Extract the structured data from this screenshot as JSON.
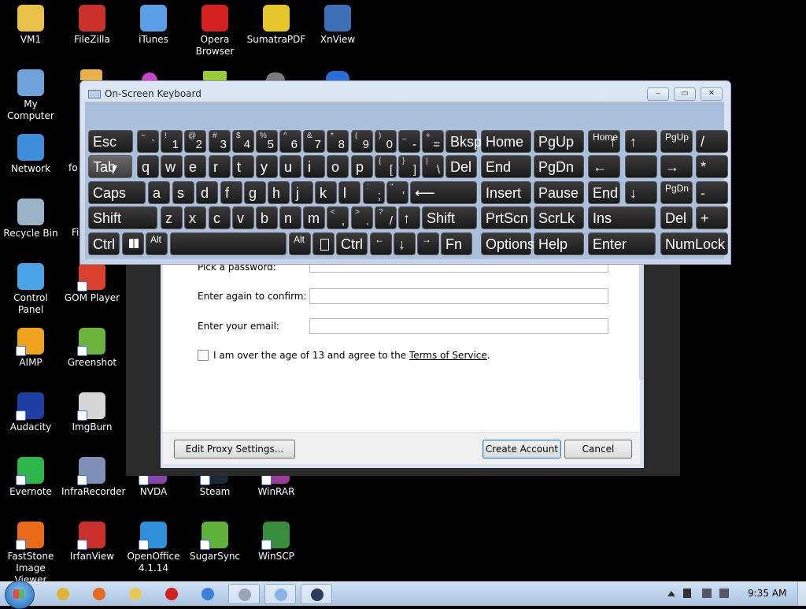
{
  "desktop": {
    "icons": [
      {
        "label": "VM1",
        "icon": "folder-icon",
        "color": "#e9c14a"
      },
      {
        "label": "FileZilla",
        "icon": "filezilla-icon",
        "color": "#c9302c"
      },
      {
        "label": "iTunes",
        "icon": "itunes-icon",
        "color": "#5a9ee6"
      },
      {
        "label": "Opera Browser",
        "icon": "opera-icon",
        "color": "#d4201f"
      },
      {
        "label": "SumatraPDF",
        "icon": "sumatrapdf-icon",
        "color": "#e6c52a"
      },
      {
        "label": "XnView",
        "icon": "xnview-icon",
        "color": "#3d6fb6"
      },
      {
        "label": "My Computer",
        "icon": "computer-icon",
        "color": "#6fa3d8"
      },
      {
        "label": "Network",
        "icon": "network-icon",
        "color": "#3c8fd8"
      },
      {
        "label": "Recycle Bin",
        "icon": "recycle-bin-icon",
        "color": "#9bb3c6"
      },
      {
        "label": "Control Panel",
        "icon": "control-panel-icon",
        "color": "#4aa3e6"
      },
      {
        "label": "GOM Player",
        "icon": "gom-player-icon",
        "color": "#d9412c"
      },
      {
        "label": "AIMP",
        "icon": "aimp-icon",
        "color": "#f0a31c"
      },
      {
        "label": "Greenshot",
        "icon": "greenshot-icon",
        "color": "#6cb33e"
      },
      {
        "label": "Audacity",
        "icon": "audacity-icon",
        "color": "#1f3fa3"
      },
      {
        "label": "ImgBurn",
        "icon": "imgburn-icon",
        "color": "#d6d6d6"
      },
      {
        "label": "Evernote",
        "icon": "evernote-icon",
        "color": "#2fb64a"
      },
      {
        "label": "InfraRecorder",
        "icon": "infrarecorder-icon",
        "color": "#7f8fb6"
      },
      {
        "label": "NVDA",
        "icon": "nvda-icon",
        "color": "#8b44ac"
      },
      {
        "label": "Steam",
        "icon": "steam-icon",
        "color": "#1b2838"
      },
      {
        "label": "WinRAR",
        "icon": "winrar-icon",
        "color": "#9b3b9b"
      },
      {
        "label": "FastStone Image Viewer",
        "icon": "faststone-icon",
        "color": "#e86b1c"
      },
      {
        "label": "IrfanView",
        "icon": "irfanview-icon",
        "color": "#c9302c"
      },
      {
        "label": "OpenOffice 4.1.14",
        "icon": "openoffice-icon",
        "color": "#2f8fd8"
      },
      {
        "label": "SugarSync",
        "icon": "sugarsync-icon",
        "color": "#5fb33a"
      },
      {
        "label": "WinSCP",
        "icon": "winscp-icon",
        "color": "#3a8d3a"
      }
    ],
    "partial_labels": {
      "fo": "fo",
      "fi": "Fi"
    }
  },
  "steam_dialog": {
    "password_label": "Pick a password:",
    "confirm_label": "Enter again to confirm:",
    "email_label": "Enter your email:",
    "tos_prefix": "I am over the age of 13 and agree to the ",
    "tos_link": "Terms of Service",
    "tos_suffix": ".",
    "proxy_button": "Edit Proxy Settings...",
    "create_button": "Create Account",
    "cancel_button": "Cancel"
  },
  "osk": {
    "title": "On-Screen Keyboard",
    "minimize": "–",
    "restore": "▭",
    "close": "✕",
    "rows": [
      [
        {
          "t": "Esc"
        },
        {
          "s": "~",
          "b": "`"
        },
        {
          "s": "!",
          "b": "1"
        },
        {
          "s": "@",
          "b": "2"
        },
        {
          "s": "#",
          "b": "3"
        },
        {
          "s": "$",
          "b": "4"
        },
        {
          "s": "%",
          "b": "5"
        },
        {
          "s": "^",
          "b": "6"
        },
        {
          "s": "&",
          "b": "7"
        },
        {
          "s": "*",
          "b": "8"
        },
        {
          "s": "(",
          "b": "9"
        },
        {
          "s": ")",
          "b": "0"
        },
        {
          "s": "_",
          "b": "-"
        },
        {
          "s": "+",
          "b": "="
        },
        {
          "t": "Bksp"
        },
        {
          "t": "Home"
        },
        {
          "t": "PgUp"
        },
        {
          "t": "Home",
          "n": "↑",
          "sm": true
        },
        {
          "t": "↑"
        },
        {
          "t": "PgUp",
          "sm": true
        },
        {
          "t": "/"
        }
      ],
      [
        {
          "t": "Tab"
        },
        {
          "t": "q"
        },
        {
          "t": "w"
        },
        {
          "t": "e"
        },
        {
          "t": "r"
        },
        {
          "t": "t"
        },
        {
          "t": "y"
        },
        {
          "t": "u"
        },
        {
          "t": "i"
        },
        {
          "t": "o"
        },
        {
          "t": "p"
        },
        {
          "s": "{",
          "b": "["
        },
        {
          "s": "}",
          "b": "]"
        },
        {
          "s": "|",
          "b": "\\"
        },
        {
          "t": "Del"
        },
        {
          "t": "End"
        },
        {
          "t": "PgDn"
        },
        {
          "t": "←"
        },
        {
          "t": ""
        },
        {
          "t": "→"
        },
        {
          "t": "*"
        }
      ],
      [
        {
          "t": "Caps"
        },
        {
          "t": "a"
        },
        {
          "t": "s"
        },
        {
          "t": "d"
        },
        {
          "t": "f"
        },
        {
          "t": "g"
        },
        {
          "t": "h"
        },
        {
          "t": "j"
        },
        {
          "t": "k"
        },
        {
          "t": "l"
        },
        {
          "s": ":",
          "b": ";"
        },
        {
          "s": "\"",
          "b": "'"
        },
        {
          "t": "⟵"
        },
        {
          "t": "Insert"
        },
        {
          "t": "Pause"
        },
        {
          "t": "End"
        },
        {
          "t": "↓"
        },
        {
          "t": "PgDn",
          "sm": true
        },
        {
          "t": "-"
        }
      ],
      [
        {
          "t": "Shift"
        },
        {
          "t": "z"
        },
        {
          "t": "x"
        },
        {
          "t": "c"
        },
        {
          "t": "v"
        },
        {
          "t": "b"
        },
        {
          "t": "n"
        },
        {
          "t": "m"
        },
        {
          "s": "<",
          "b": ","
        },
        {
          "s": ">",
          "b": "."
        },
        {
          "s": "?",
          "b": "/"
        },
        {
          "t": "↑"
        },
        {
          "t": "Shift"
        },
        {
          "t": "PrtScn"
        },
        {
          "t": "ScrLk"
        },
        {
          "t": "Ins"
        },
        {
          "t": "Del"
        },
        {
          "t": "+"
        }
      ],
      [
        {
          "t": "Ctrl"
        },
        {
          "t": "win"
        },
        {
          "t": "Alt",
          "sm": true
        },
        {
          "t": ""
        },
        {
          "t": "Alt",
          "sm": true
        },
        {
          "t": "menu"
        },
        {
          "t": "Ctrl"
        },
        {
          "t": "←",
          "sm": true
        },
        {
          "t": "↓"
        },
        {
          "t": "→",
          "sm": true
        },
        {
          "t": "Fn"
        },
        {
          "t": "Options"
        },
        {
          "t": "Help"
        },
        {
          "t": "Enter"
        },
        {
          "t": "NumLock"
        }
      ]
    ]
  },
  "taskbar": {
    "clock": "9:35 AM",
    "apps": [
      {
        "icon": "chrome-icon",
        "color": "#e0b33b"
      },
      {
        "icon": "firefox-icon",
        "color": "#e66a1f"
      },
      {
        "icon": "explorer-icon",
        "color": "#e8c85a"
      },
      {
        "icon": "opera-icon",
        "color": "#d4201f"
      },
      {
        "icon": "app-icon",
        "color": "#3a7fd8"
      },
      {
        "icon": "accessibility-icon",
        "color": "#9aa6b3",
        "active": true
      },
      {
        "icon": "keyboard-icon",
        "color": "#8ab4e6",
        "active": true
      },
      {
        "icon": "steam-icon",
        "color": "#2a3c57",
        "active": true
      }
    ]
  }
}
